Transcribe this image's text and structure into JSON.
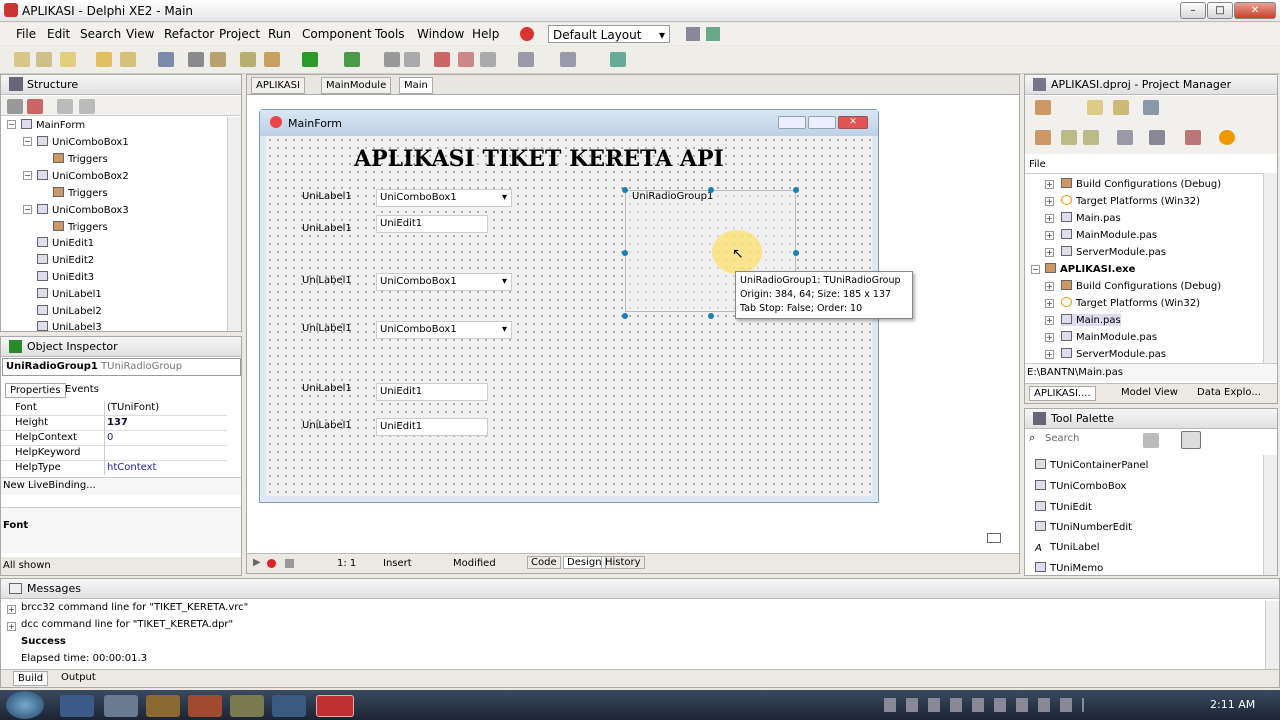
{
  "window": {
    "title": "APLIKASI - Delphi XE2 - Main"
  },
  "menu": [
    "File",
    "Edit",
    "Search",
    "View",
    "Refactor",
    "Project",
    "Run",
    "Component",
    "Tools",
    "Window",
    "Help"
  ],
  "layout_select": "Default Layout",
  "structure": {
    "title": "Structure",
    "items": [
      "MainForm",
      "UniComboBox1",
      "Triggers",
      "UniComboBox2",
      "Triggers",
      "UniComboBox3",
      "Triggers",
      "UniEdit1",
      "UniEdit2",
      "UniEdit3",
      "UniLabel1",
      "UniLabel2",
      "UniLabel3"
    ]
  },
  "inspector": {
    "title": "Object Inspector",
    "object": "UniRadioGroup1",
    "type": "TUniRadioGroup",
    "tabs": [
      "Properties",
      "Events"
    ],
    "props": [
      {
        "name": "Font",
        "value": "(TUniFont)"
      },
      {
        "name": "Height",
        "value": "137"
      },
      {
        "name": "HelpContext",
        "value": "0"
      },
      {
        "name": "HelpKeyword",
        "value": ""
      },
      {
        "name": "HelpType",
        "value": "htContext"
      }
    ],
    "livebinding": "New LiveBinding...",
    "desc": "Font",
    "status": "All shown"
  },
  "editor_tabs": [
    "APLIKASI",
    "MainModule",
    "Main"
  ],
  "form": {
    "caption": "MainForm",
    "heading": "APLIKASI TIKET KERETA API",
    "labels": [
      "UniLabel1",
      "UniLabel1",
      "UniLabel1",
      "UniLabel1",
      "UniLabel1",
      "UniLabel1"
    ],
    "combos": [
      "UniComboBox1",
      "UniComboBox1",
      "UniComboBox1"
    ],
    "edits": [
      "UniEdit1",
      "UniEdit1",
      "UniEdit1"
    ],
    "radio_group": "UniRadioGroup1",
    "tooltip": [
      "UniRadioGroup1: TUniRadioGroup",
      "Origin: 384, 64; Size: 185 x 137",
      "Tab Stop: False; Order: 10"
    ]
  },
  "editor_status": {
    "pos": "1:   1",
    "mode": "Insert",
    "state": "Modified",
    "tabs": [
      "Code",
      "Design",
      "History"
    ]
  },
  "project_manager": {
    "title": "APLIKASI.dproj - Project Manager",
    "file_label": "File",
    "items": [
      "Build Configurations (Debug)",
      "Target Platforms (Win32)",
      "Main.pas",
      "MainModule.pas",
      "ServerModule.pas",
      "APLIKASI.exe",
      "Build Configurations (Debug)",
      "Target Platforms (Win32)",
      "Main.pas",
      "MainModule.pas",
      "ServerModule.pas"
    ],
    "path": "E:\\BANTN\\Main.pas",
    "tabs": [
      "APLIKASI....",
      "Model View",
      "Data Explo..."
    ]
  },
  "tool_palette": {
    "title": "Tool Palette",
    "search": "Search",
    "items": [
      "TUniContainerPanel",
      "TUniComboBox",
      "TUniEdit",
      "TUniNumberEdit",
      "TUniLabel",
      "TUniMemo"
    ]
  },
  "messages": {
    "title": "Messages",
    "lines": [
      "brcc32 command line for \"TIKET_KERETA.vrc\"",
      "dcc command line for \"TIKET_KERETA.dpr\"",
      "Success",
      "Elapsed time: 00:00:01.3"
    ],
    "tabs": [
      "Build",
      "Output"
    ]
  },
  "taskbar": {
    "clock": "2:11 AM"
  }
}
